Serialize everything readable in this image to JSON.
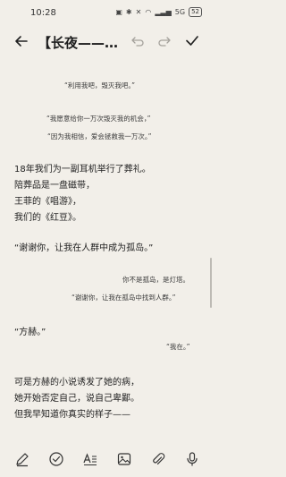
{
  "status": {
    "time": "10:28",
    "signal_text": "5G",
    "battery": "52"
  },
  "header": {
    "title": "【长夜——雪..."
  },
  "content": {
    "lines": [
      "“利用我吧，毁灭我吧。”",
      "“我愿意给你一万次毁灭我的机会，”",
      "“因为我相信，爱会拯救我一万次。”",
      "18年我们为一副耳机举行了葬礼。",
      "陪葬品是一盘磁带，",
      "王菲的《唱游》，",
      "我们的《红豆》。",
      "“谢谢你，让我在人群中成为孤岛。”",
      "你不是孤岛，是灯塔。",
      "“谢谢你，让我在孤岛中找到人群。”",
      "“方赫。”",
      "“我在。”",
      "可是方赫的小说诱发了她的病，",
      "她开始否定自己，说自己卑鄙。",
      "但我早知道你真实的样子——"
    ]
  },
  "toolbar": {
    "icons": [
      "pen-icon",
      "check-circle-icon",
      "text-format-icon",
      "image-icon",
      "attachment-icon",
      "microphone-icon"
    ]
  }
}
